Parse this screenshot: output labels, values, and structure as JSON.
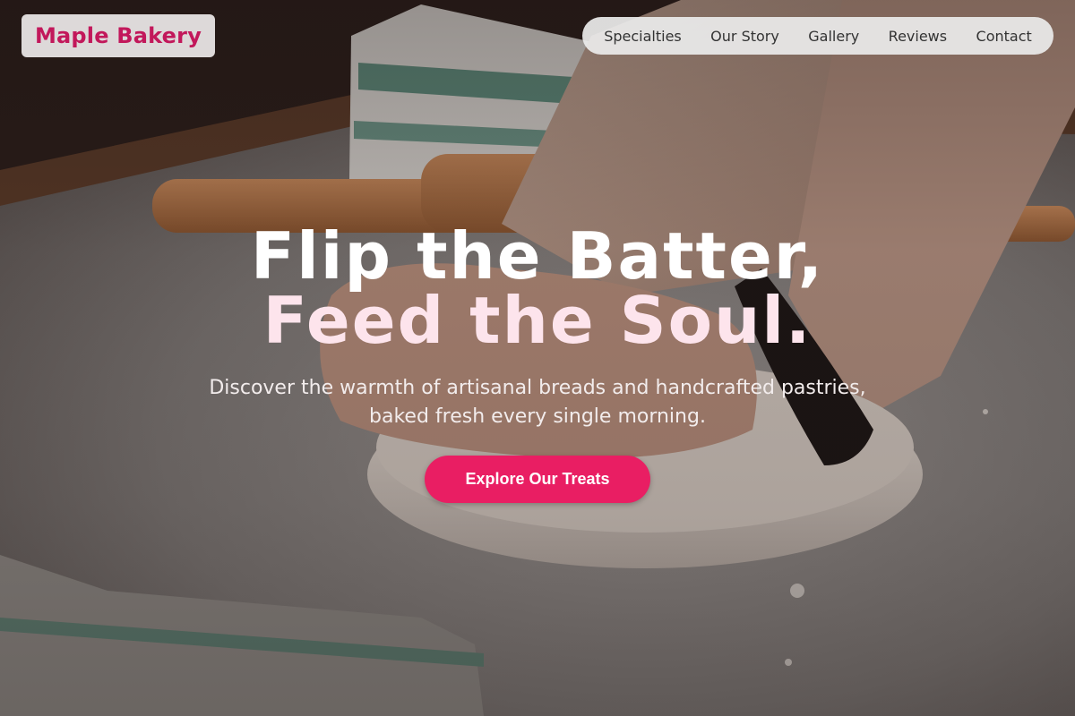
{
  "brand": {
    "name": "Maple Bakery"
  },
  "nav": {
    "items": [
      {
        "label": "Specialties"
      },
      {
        "label": "Our Story"
      },
      {
        "label": "Gallery"
      },
      {
        "label": "Reviews"
      },
      {
        "label": "Contact"
      }
    ]
  },
  "hero": {
    "headline_line1": "Flip the Batter,",
    "headline_line2": "Feed the Soul.",
    "subtitle_line1": "Discover the warmth of artisanal breads and handcrafted pastries,",
    "subtitle_line2": "baked fresh every single morning.",
    "cta_label": "Explore Our Treats"
  },
  "colors": {
    "brand_pink": "#c2185b",
    "cta_pink": "#e91e63",
    "headline_white": "#ffffff",
    "headline_pink": "#fde4ec"
  },
  "background_image": {
    "semantic": "hands kneading dough on floured table with rolling pin and striped towels"
  }
}
